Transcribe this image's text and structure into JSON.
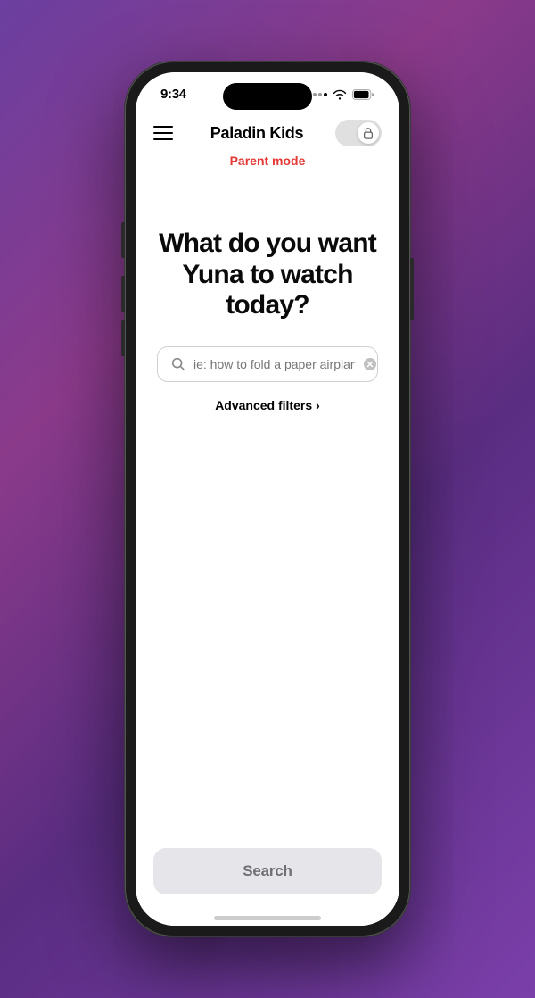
{
  "status": {
    "time": "9:34",
    "dots": 4,
    "wifi": true,
    "battery": true
  },
  "header": {
    "title": "Paladin Kids",
    "parent_mode": "Parent mode"
  },
  "main": {
    "headline_line1": "What do you want",
    "headline_line2": "Yuna to watch today?",
    "search_placeholder": "ie: how to fold a paper airplane",
    "advanced_filters": "Advanced filters",
    "chevron": "›"
  },
  "footer": {
    "search_button": "Search"
  },
  "icons": {
    "menu": "menu-icon",
    "lock": "lock-icon",
    "search": "search-icon",
    "clear": "clear-icon",
    "chevron_right": "chevron-right-icon"
  }
}
